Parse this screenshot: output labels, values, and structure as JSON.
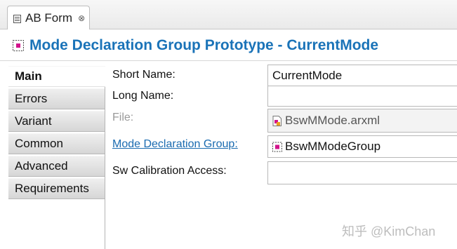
{
  "editor_tab": {
    "label": "AB Form",
    "close": "⊗"
  },
  "header": {
    "title": "Mode Declaration Group Prototype - CurrentMode"
  },
  "nav": {
    "items": [
      "Main",
      "Errors",
      "Variant",
      "Common",
      "Advanced",
      "Requirements"
    ]
  },
  "form": {
    "short_name": {
      "label": "Short Name:",
      "value": "CurrentMode"
    },
    "long_name": {
      "label": "Long Name:",
      "value": ""
    },
    "file": {
      "label": "File:",
      "value": "BswMMode.arxml"
    },
    "mode_declaration_group": {
      "label": "Mode Declaration Group:",
      "value": "BswMModeGroup"
    },
    "sw_calibration_access": {
      "label": "Sw Calibration Access:",
      "value": ""
    }
  },
  "watermark": "知乎 @KimChan",
  "colors": {
    "title": "#1a73b8",
    "link": "#1a6bb0"
  }
}
